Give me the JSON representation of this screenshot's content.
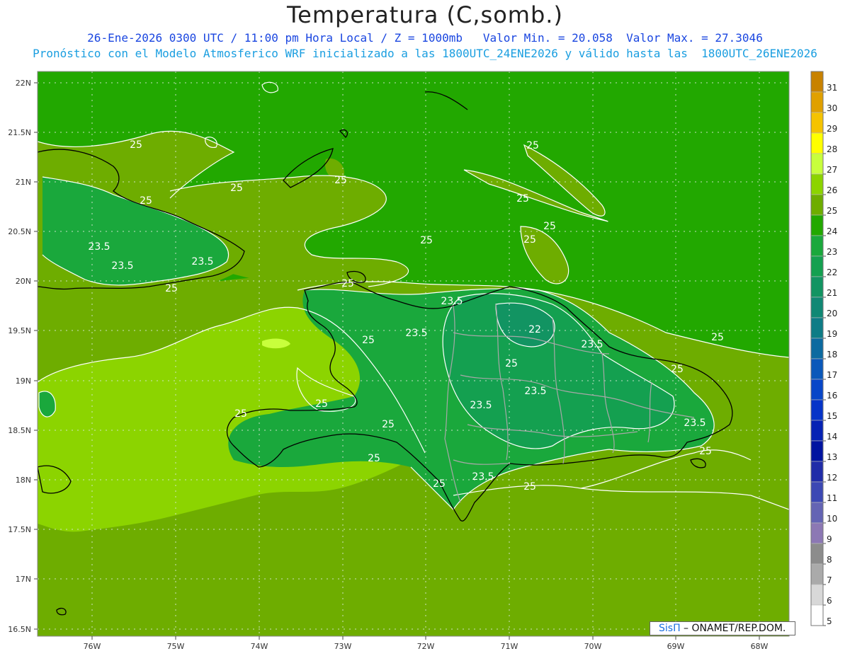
{
  "header": {
    "title": "Temperatura (C,somb.)",
    "line1": "26-Ene-2026 0300 UTC / 11:00 pm Hora Local / Z = 1000mb   Valor Min. = 20.058  Valor Max. = 27.3046",
    "line2": "Pronóstico con el Modelo Atmosferico WRF inicializado a las 1800UTC_24ENE2026 y válido hasta las  1800UTC_26ENE2026"
  },
  "map": {
    "lat_labels": [
      "22N",
      "21.5N",
      "21N",
      "20.5N",
      "20N",
      "19.5N",
      "19N",
      "18.5N",
      "18N",
      "17.5N",
      "17N",
      "16.5N"
    ],
    "lon_labels": [
      "76W",
      "75W",
      "74W",
      "73W",
      "72W",
      "71W",
      "70W",
      "69W",
      "68W"
    ],
    "contour_labels": [
      {
        "text": "25"
      },
      {
        "text": "25"
      },
      {
        "text": "25"
      },
      {
        "text": "25"
      },
      {
        "text": "25"
      },
      {
        "text": "25"
      },
      {
        "text": "25"
      },
      {
        "text": "25"
      },
      {
        "text": "25"
      },
      {
        "text": "25"
      },
      {
        "text": "25"
      },
      {
        "text": "25"
      },
      {
        "text": "25"
      },
      {
        "text": "25"
      },
      {
        "text": "25"
      },
      {
        "text": "25"
      },
      {
        "text": "25"
      },
      {
        "text": "25"
      },
      {
        "text": "25"
      },
      {
        "text": "25"
      },
      {
        "text": "25"
      },
      {
        "text": "25"
      },
      {
        "text": "23.5"
      },
      {
        "text": "23.5"
      },
      {
        "text": "23.5"
      },
      {
        "text": "23.5"
      },
      {
        "text": "23.5"
      },
      {
        "text": "23.5"
      },
      {
        "text": "23.5"
      },
      {
        "text": "23.5"
      },
      {
        "text": "23.5"
      },
      {
        "text": "23.5"
      },
      {
        "text": "22"
      }
    ]
  },
  "legend": {
    "entries": [
      {
        "value": "31",
        "color": "#c88200"
      },
      {
        "value": "30",
        "color": "#e0a000"
      },
      {
        "value": "29",
        "color": "#f5c300"
      },
      {
        "value": "28",
        "color": "#ffff00"
      },
      {
        "value": "27",
        "color": "#c8ff3c"
      },
      {
        "value": "26",
        "color": "#8cd400"
      },
      {
        "value": "25",
        "color": "#6ead00"
      },
      {
        "value": "24",
        "color": "#22a800"
      },
      {
        "value": "23",
        "color": "#1aa83c"
      },
      {
        "value": "22",
        "color": "#14a050"
      },
      {
        "value": "21",
        "color": "#129462"
      },
      {
        "value": "20",
        "color": "#108874"
      },
      {
        "value": "19",
        "color": "#0e7c86"
      },
      {
        "value": "18",
        "color": "#0c6aa0"
      },
      {
        "value": "17",
        "color": "#0a58ba"
      },
      {
        "value": "16",
        "color": "#0846c8"
      },
      {
        "value": "15",
        "color": "#0634c8"
      },
      {
        "value": "14",
        "color": "#0622b4"
      },
      {
        "value": "13",
        "color": "#0014a0"
      },
      {
        "value": "12",
        "color": "#202ca8"
      },
      {
        "value": "11",
        "color": "#3c48b4"
      },
      {
        "value": "10",
        "color": "#6464b4"
      },
      {
        "value": "9",
        "color": "#8c78b4"
      },
      {
        "value": "8",
        "color": "#8c8c8c"
      },
      {
        "value": "7",
        "color": "#aaaaaa"
      },
      {
        "value": "6",
        "color": "#d8d8d8"
      },
      {
        "value": "5",
        "color": "#ffffff"
      }
    ]
  },
  "credit": {
    "sis": "SisΠ",
    "rest": " – ONAMET/REP.DOM."
  }
}
